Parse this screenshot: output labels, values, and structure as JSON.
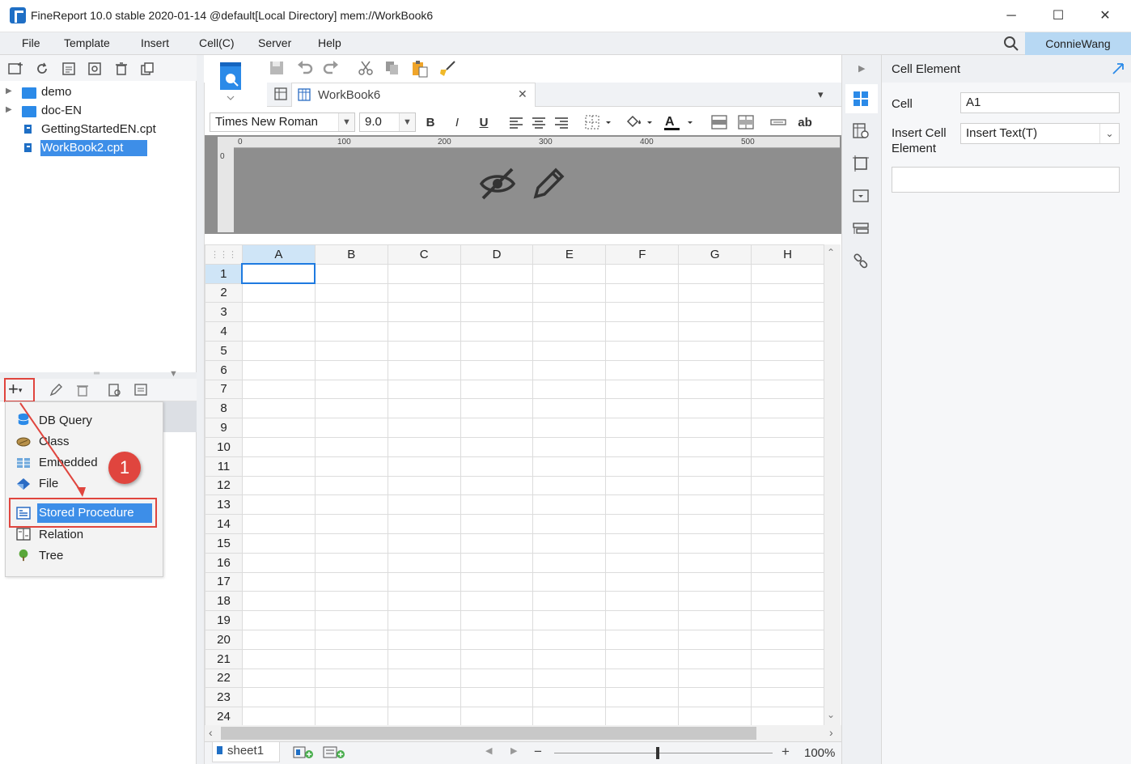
{
  "window": {
    "title": "FineReport 10.0 stable 2020-01-14 @default[Local Directory]    mem://WorkBook6",
    "minimize": "─",
    "maximize": "☐",
    "close": "✕"
  },
  "menu": {
    "items": [
      "File",
      "Template",
      "Insert",
      "Cell(C)",
      "Server",
      "Help"
    ],
    "user": "ConnieWang"
  },
  "file_tree": {
    "items": [
      {
        "label": "demo",
        "type": "folder"
      },
      {
        "label": "doc-EN",
        "type": "folder"
      },
      {
        "label": "GettingStartedEN.cpt",
        "type": "file"
      },
      {
        "label": "WorkBook2.cpt",
        "type": "file",
        "selected": true
      }
    ]
  },
  "datasource_menu": {
    "items": [
      {
        "label": "DB Query",
        "icon": "database-icon"
      },
      {
        "label": "Class",
        "icon": "class-icon"
      },
      {
        "label": "Embedded",
        "icon": "embedded-icon"
      },
      {
        "label": "File",
        "icon": "file-icon"
      },
      {
        "label": "Stored Procedure",
        "icon": "stored-procedure-icon",
        "highlighted": true
      },
      {
        "label": "Relation",
        "icon": "relation-icon"
      },
      {
        "label": "Tree",
        "icon": "tree-icon"
      }
    ],
    "annotation_number": "1"
  },
  "editor": {
    "tab_label": "WorkBook6",
    "font_name": "Times New Roman",
    "font_size": "9.0",
    "bold": "B",
    "italic": "I",
    "underline": "U",
    "ab_label": "ab",
    "ruler_ticks": [
      "0",
      "100",
      "200",
      "300",
      "400",
      "500"
    ],
    "ruler_left_tick": "0"
  },
  "grid": {
    "columns": [
      "A",
      "B",
      "C",
      "D",
      "E",
      "F",
      "G",
      "H"
    ],
    "rows": [
      "1",
      "2",
      "3",
      "4",
      "5",
      "6",
      "7",
      "8",
      "9",
      "10",
      "11",
      "12",
      "13",
      "14",
      "15",
      "16",
      "17",
      "18",
      "19",
      "20",
      "21",
      "22",
      "23",
      "24"
    ],
    "selected_cell": "A1"
  },
  "bottom": {
    "sheet": "sheet1",
    "zoom": "100%",
    "zoom_minus": "−",
    "zoom_plus": "+"
  },
  "properties": {
    "title": "Cell Element",
    "cell_label": "Cell",
    "cell_value": "A1",
    "insert_label_line1": "Insert Cell",
    "insert_label_line2": "Element",
    "insert_value": "Insert Text(T)"
  },
  "colors": {
    "accent": "#1e7ae0",
    "selection": "#3d8ee8",
    "annotation": "#e0453e",
    "user_badge": "#b7d8f3"
  }
}
